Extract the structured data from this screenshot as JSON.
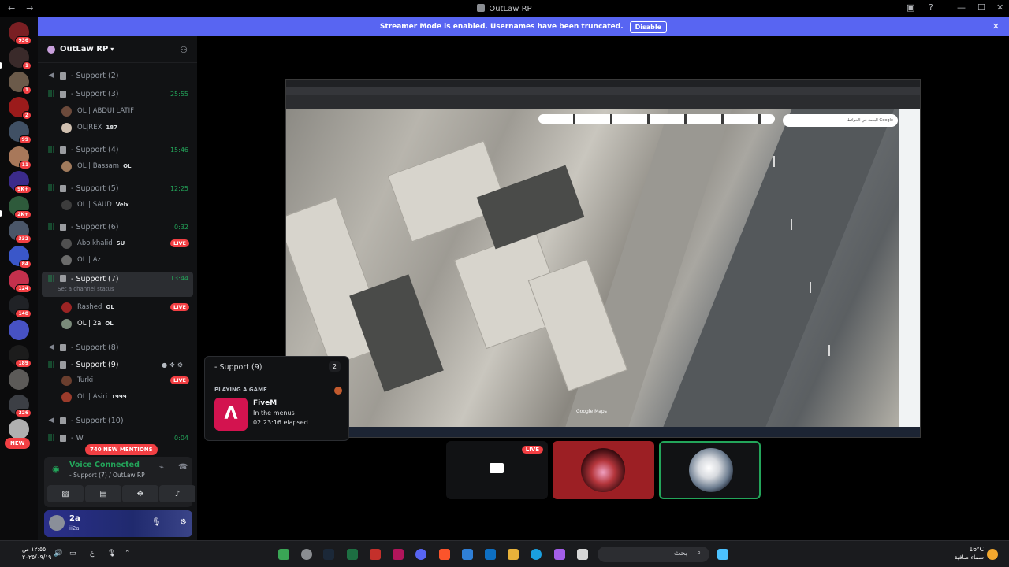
{
  "window": {
    "title": "OutLaw RP",
    "back": "←",
    "forward": "→",
    "min": "—",
    "max": "☐",
    "close": "✕"
  },
  "rail": {
    "new_label": "NEW",
    "servers": [
      {
        "badge": "936",
        "color": "#7a1f23"
      },
      {
        "badge": "1",
        "color": "#3a2a2a"
      },
      {
        "badge": "1",
        "color": "#6b5a4a"
      },
      {
        "badge": "2",
        "color": "#9b1b1b"
      },
      {
        "badge": "99",
        "color": "#405064"
      },
      {
        "badge": "11",
        "color": "#a8785a"
      },
      {
        "badge": "9K+",
        "color": "#3b2b8a"
      },
      {
        "badge": "2K+",
        "color": "#2e5a3b"
      },
      {
        "badge": "332",
        "color": "#4a5668"
      },
      {
        "badge": "84",
        "color": "#3a57c9"
      },
      {
        "badge": "124",
        "color": "#c4304c"
      },
      {
        "badge": "148",
        "color": "#202226"
      },
      {
        "badge": "",
        "color": "#4752c4"
      },
      {
        "badge": "189",
        "color": "#1c1c1c"
      },
      {
        "badge": "",
        "color": "#5c5a58"
      },
      {
        "badge": "226",
        "color": "#3c3f45"
      },
      {
        "badge": "",
        "color": "#b0b0b0"
      }
    ]
  },
  "banner": {
    "text": "Streamer Mode is enabled. Usernames have been truncated.",
    "button": "Disable",
    "close": "✕"
  },
  "server": {
    "name": "OutLaw RP"
  },
  "channels": [
    {
      "name": "- Support (2)",
      "time": ""
    },
    {
      "name": "- Support (3)",
      "time": "25:55"
    },
    {
      "name": "- Support (4)",
      "time": "15:46"
    },
    {
      "name": "- Support (5)",
      "time": "12:25"
    },
    {
      "name": "- Support (6)",
      "time": "0:32"
    },
    {
      "name": "- Support (7)",
      "time": "13:44",
      "status": "Set a channel status"
    },
    {
      "name": "- Support (8)",
      "time": ""
    },
    {
      "name": "- Support (9)",
      "time": ""
    },
    {
      "name": "- Support (10)",
      "time": ""
    },
    {
      "name": "- W",
      "time": "0:04"
    }
  ],
  "members": [
    {
      "name": "OL | ABDUI LATIF",
      "tag": "",
      "color": "#6c4a3b"
    },
    {
      "name": "OL|REX",
      "tag": "187",
      "color": "#d0c0b0"
    },
    {
      "name": "OL | Bassam",
      "tag": "OL",
      "color": "#a07a5c"
    },
    {
      "name": "OL | SAUD",
      "tag": "Velx",
      "color": "#3c3c3c"
    },
    {
      "name": "Abo.khalid",
      "tag": "SU",
      "color": "#505050"
    },
    {
      "name": "OL | Az",
      "tag": "",
      "color": "#6b6b6b"
    },
    {
      "name": "Rashed",
      "tag": "OL",
      "color": "#9b2424"
    },
    {
      "name": "OL | 2a",
      "tag": "OL",
      "color": "#7b8b7b"
    },
    {
      "name": "Turki",
      "tag": "",
      "color": "#6a3e2e"
    },
    {
      "name": "OL | Asiri",
      "tag": "1999",
      "color": "#9b3b2b"
    }
  ],
  "live_label": "LIVE",
  "mentions": "740 NEW MENTIONS",
  "voice": {
    "status": "Voice Connected",
    "channel": "- Support (7) / OutLaw RP"
  },
  "user": {
    "name": "2a",
    "status": "ii2a"
  },
  "popup": {
    "channel": "- Support (9)",
    "count": "2",
    "section": "PLAYING A GAME",
    "game": "FiveM",
    "state": "In the menus",
    "elapsed": "02:23:16 elapsed"
  },
  "stream": {
    "search_text": "البحث في الخرائط Google",
    "watermark": "Google Maps"
  },
  "taskbar": {
    "time": "١٢:٥٥ ص",
    "date": "٢٠٢٥/٠٩/١٩",
    "lang": "ع",
    "search": "بحث",
    "temp": "16°C",
    "weather": "سماء صافية"
  }
}
